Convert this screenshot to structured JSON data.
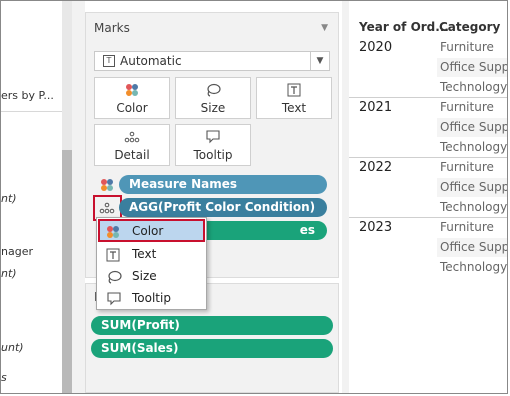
{
  "left_pane": {
    "fragments": [
      "ers by P...",
      "nt)",
      "nager",
      "nt)",
      "unt)",
      "s"
    ]
  },
  "marks": {
    "title": "Marks",
    "mark_type": "Automatic",
    "buttons": [
      {
        "label": "Color",
        "icon": "color-dots-icon"
      },
      {
        "label": "Size",
        "icon": "size-lasso-icon"
      },
      {
        "label": "Text",
        "icon": "text-t-icon"
      },
      {
        "label": "Detail",
        "icon": "detail-dots-icon"
      },
      {
        "label": "Tooltip",
        "icon": "tooltip-bubble-icon"
      }
    ],
    "pills": [
      {
        "label": "Measure Names",
        "color": "#4f96b7"
      },
      {
        "label": "AGG(Profit Color Condition)",
        "color": "#3a7f9e"
      },
      {
        "label": "es",
        "color": "#1aa37a"
      }
    ]
  },
  "context_menu": {
    "items": [
      {
        "label": "Color",
        "icon": "color-dots-icon",
        "selected": true
      },
      {
        "label": "Text",
        "icon": "text-t-icon",
        "selected": false
      },
      {
        "label": "Size",
        "icon": "size-lasso-icon",
        "selected": false
      },
      {
        "label": "Tooltip",
        "icon": "tooltip-bubble-icon",
        "selected": false
      }
    ]
  },
  "measure_values": {
    "title": "M",
    "pills": [
      "SUM(Profit)",
      "SUM(Sales)"
    ]
  },
  "table": {
    "headers": {
      "year": "Year of Ord...",
      "category": "Category"
    },
    "groups": [
      {
        "year": "2020",
        "categories": [
          "Furniture",
          "Office Supp",
          "Technology"
        ]
      },
      {
        "year": "2021",
        "categories": [
          "Furniture",
          "Office Supp",
          "Technology"
        ]
      },
      {
        "year": "2022",
        "categories": [
          "Furniture",
          "Office Supp",
          "Technology"
        ]
      },
      {
        "year": "2023",
        "categories": [
          "Furniture",
          "Office Supp",
          "Technology"
        ]
      }
    ]
  },
  "colors": {
    "highlight_border": "#c8102e",
    "pill_blue": "#4f96b7",
    "pill_blue_dark": "#3a7f9e",
    "pill_green": "#1aa37a",
    "menu_selected": "#bcd6ee"
  }
}
